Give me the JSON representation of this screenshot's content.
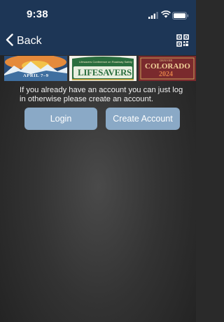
{
  "status_bar": {
    "time": "9:38",
    "signal_icon": "signal-icon",
    "wifi_icon": "wifi-icon",
    "battery_icon": "battery-icon"
  },
  "nav": {
    "back_label": "Back",
    "back_icon": "chevron-left-icon",
    "qr_icon": "qr-code-icon"
  },
  "banner": {
    "tiles": [
      {
        "name": "mountains-tile",
        "text": "APRIL 7–9"
      },
      {
        "name": "lifesavers-tile",
        "text": "LIFESAVERS",
        "subtext": "Lifesavers Conference on Roadway Safety"
      },
      {
        "name": "colorado-tile",
        "text": "COLORADO",
        "year": "2024",
        "tag": "DENVER"
      }
    ]
  },
  "main": {
    "message": "If you already have an account you can just log in otherwise please create an account.",
    "login_label": "Login",
    "create_account_label": "Create Account"
  },
  "colors": {
    "header_bg": "#1d3656",
    "button_bg": "#8aa9c6",
    "page_bg": "#333333"
  }
}
